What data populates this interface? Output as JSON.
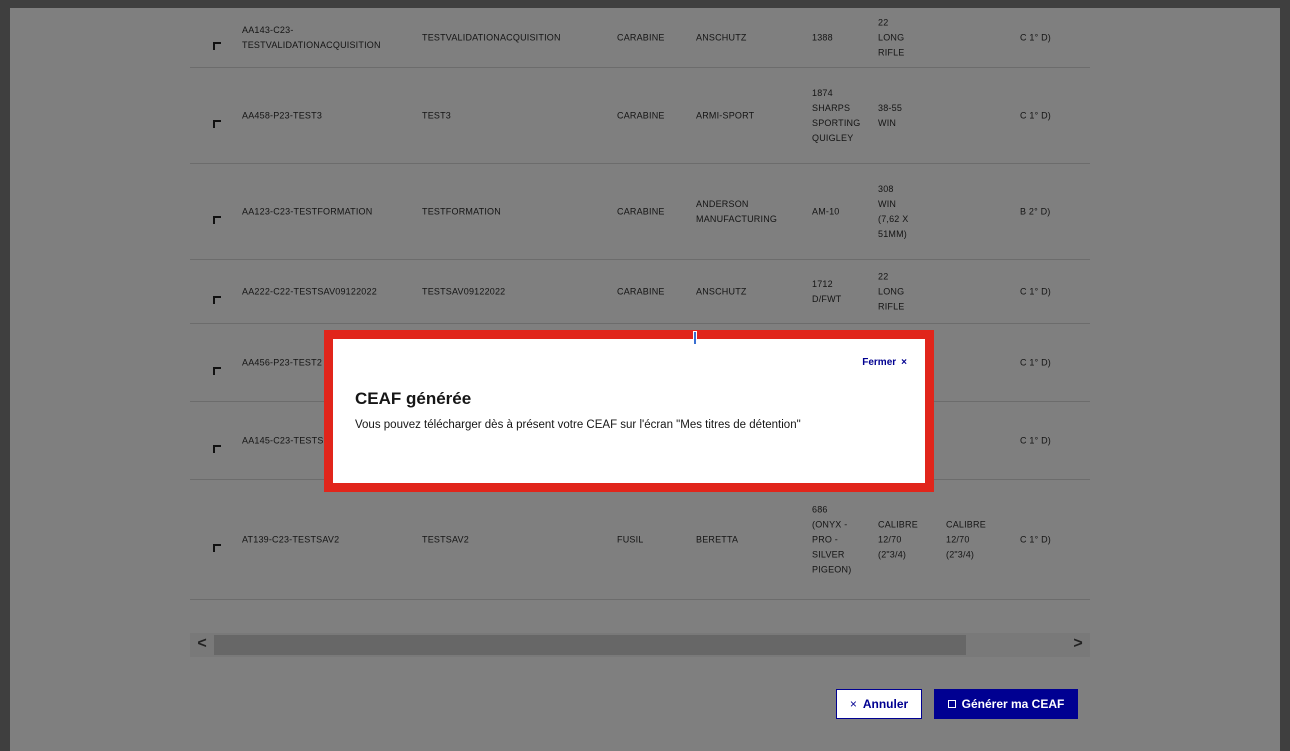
{
  "table": {
    "rows": [
      {
        "id": [
          "AA143-C23-",
          "TESTVALIDATIONACQUISITION"
        ],
        "name": [
          "TESTVALIDATIONACQUISITION"
        ],
        "type": [
          "CARABINE"
        ],
        "mark": [
          "ANSCHUTZ"
        ],
        "model": [
          "1388"
        ],
        "cal1": [
          "22",
          "LONG",
          "RIFLE"
        ],
        "cal2": [
          ""
        ],
        "cat": "C 1° d)"
      },
      {
        "id": [
          "AA458-P23-TEST3"
        ],
        "name": [
          "TEST3"
        ],
        "type": [
          "CARABINE"
        ],
        "mark": [
          "ARMI-SPORT"
        ],
        "model": [
          "1874",
          "SHARPS",
          "SPORTING",
          "QUIGLEY"
        ],
        "cal1": [
          "38-55",
          "WIN"
        ],
        "cal2": [
          ""
        ],
        "cat": "C 1° d)"
      },
      {
        "id": [
          "AA123-C23-TESTFORMATION"
        ],
        "name": [
          "TESTFORMATION"
        ],
        "type": [
          "CARABINE"
        ],
        "mark": [
          "ANDERSON",
          "MANUFACTURING"
        ],
        "model": [
          "AM-10"
        ],
        "cal1": [
          "308",
          "WIN",
          "(7,62 X",
          "51MM)"
        ],
        "cal2": [
          ""
        ],
        "cat": "B 2° d)"
      },
      {
        "id": [
          "AA222-C22-TESTSAV09122022"
        ],
        "name": [
          "TESTSAV09122022"
        ],
        "type": [
          "CARABINE"
        ],
        "mark": [
          "ANSCHUTZ"
        ],
        "model": [
          "1712",
          "D/FWT"
        ],
        "cal1": [
          "22",
          "LONG",
          "RIFLE"
        ],
        "cal2": [
          ""
        ],
        "cat": "C 1° d)"
      },
      {
        "id": [
          "AA456-P23-TEST2"
        ],
        "name": [
          ""
        ],
        "type": [
          ""
        ],
        "mark": [
          ""
        ],
        "model": [
          ""
        ],
        "cal1": [
          ""
        ],
        "cal2": [
          ""
        ],
        "cat": "C 1° d)"
      },
      {
        "id": [
          "AA145-C23-TESTS"
        ],
        "name": [
          ""
        ],
        "type": [
          ""
        ],
        "mark": [
          ""
        ],
        "model": [
          ""
        ],
        "cal1": [
          ""
        ],
        "cal2": [
          ""
        ],
        "cat": "C 1° d)"
      },
      {
        "id": [
          "AT139-C23-TESTSAV2"
        ],
        "name": [
          "TESTSAV2"
        ],
        "type": [
          "FUSIL"
        ],
        "mark": [
          "BERETTA"
        ],
        "model": [
          "686",
          "(ONYX -",
          "PRO -",
          "SILVER",
          "PIGEON)"
        ],
        "cal1": [
          "CALIBRE",
          "12/70",
          "(2\"3/4)"
        ],
        "cal2": [
          "CALIBRE",
          "12/70",
          "(2\"3/4)"
        ],
        "cat": "C 1° d)"
      }
    ]
  },
  "scroll": {
    "left_arrow": "<",
    "right_arrow": ">"
  },
  "actions": {
    "cancel_icon": "×",
    "cancel_label": "Annuler",
    "generate_label": "Générer ma CEAF"
  },
  "modal": {
    "close_label": "Fermer",
    "close_icon": "×",
    "title": "CEAF générée",
    "body": "Vous pouvez télécharger dès à présent votre CEAF sur l'écran \"Mes titres de détention\""
  },
  "colors": {
    "primary": "#000091",
    "highlight_border": "#e1251b",
    "overlay": "#7f7f7f"
  }
}
